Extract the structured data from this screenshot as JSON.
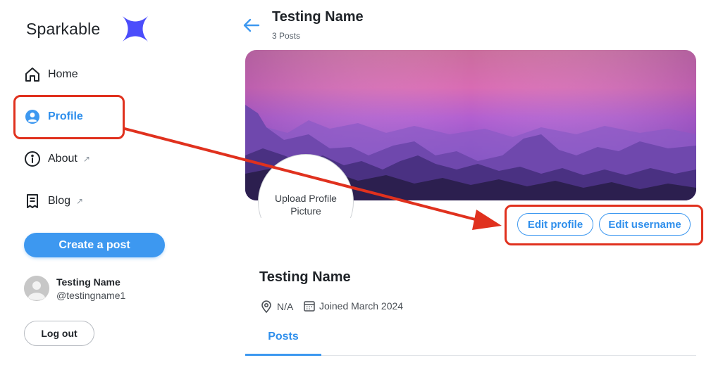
{
  "app": {
    "name": "Sparkable",
    "brand_color": "#4b4dfb"
  },
  "sidebar": {
    "items": [
      {
        "label": "Home",
        "icon": "home-icon",
        "external": false,
        "active": false
      },
      {
        "label": "Profile",
        "icon": "user-circle-icon",
        "external": false,
        "active": true
      },
      {
        "label": "About",
        "icon": "info-icon",
        "external": true,
        "active": false
      },
      {
        "label": "Blog",
        "icon": "receipt-icon",
        "external": true,
        "active": false
      }
    ],
    "external_glyph": "↗",
    "create_button": "Create a post",
    "user": {
      "name": "Testing Name",
      "handle": "@testingname1"
    },
    "logout_button": "Log out"
  },
  "header": {
    "title": "Testing Name",
    "subtitle": "3 Posts"
  },
  "profile": {
    "avatar_placeholder": "Upload Profile Picture",
    "edit_profile_button": "Edit profile",
    "edit_username_button": "Edit username",
    "name": "Testing Name",
    "location": "N/A",
    "joined": "Joined March 2024",
    "tabs": [
      "Posts"
    ]
  },
  "colors": {
    "accent": "#3d98f0",
    "annotation": "#e0311e"
  }
}
